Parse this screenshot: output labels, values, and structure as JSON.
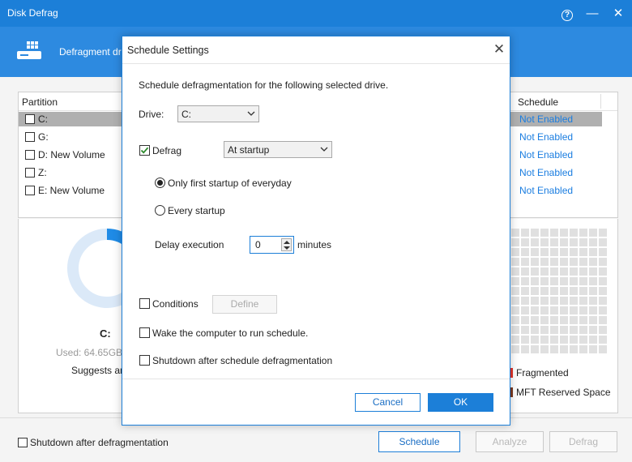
{
  "window": {
    "title": "Disk Defrag",
    "help_glyph": "?",
    "minimize_glyph": "—",
    "close_glyph": "✕"
  },
  "header": {
    "label": "Defragment driv"
  },
  "table": {
    "col_partition": "Partition",
    "col_schedule": "Schedule",
    "rows": [
      {
        "label": "C:",
        "schedule": "Not Enabled",
        "selected": true
      },
      {
        "label": "G:",
        "schedule": "Not Enabled",
        "selected": false
      },
      {
        "label": "D:  New Volume",
        "schedule": "Not Enabled",
        "selected": false
      },
      {
        "label": "Z:",
        "schedule": "Not Enabled",
        "selected": false
      },
      {
        "label": "E:  New Volume",
        "schedule": "Not Enabled",
        "selected": false
      }
    ]
  },
  "drive_panel": {
    "drive": "C:",
    "used": "Used: 64.65GB/1",
    "suggest": "Suggests ana"
  },
  "legend": {
    "fragmented": "Fragmented",
    "mft": "MFT Reserved Space"
  },
  "bottom": {
    "shutdown_label": "Shutdown after defragmentation",
    "schedule_btn": "Schedule",
    "analyze_btn": "Analyze",
    "defrag_btn": "Defrag"
  },
  "dialog": {
    "title": "Schedule Settings",
    "close_glyph": "✕",
    "intro": "Schedule defragmentation for the following selected drive.",
    "drive_label": "Drive:",
    "drive_value": "C:",
    "defrag_label": "Defrag",
    "defrag_checked": true,
    "trigger_value": "At startup",
    "radio_first": "Only first startup of everyday",
    "radio_every": "Every startup",
    "delay_label": "Delay execution",
    "delay_value": "0",
    "delay_unit": "minutes",
    "conditions_label": "Conditions",
    "define_btn": "Define",
    "wake_label": "Wake the computer to run schedule.",
    "shutdown_label": "Shutdown after schedule defragmentation",
    "cancel_btn": "Cancel",
    "ok_btn": "OK"
  },
  "colors": {
    "titlebar": "#1c7fd8",
    "header": "#2d8ae0",
    "link": "#1a7de0",
    "ring": "#1f8be6",
    "fragmented": "#e0352b",
    "mft": "#7a3a22"
  }
}
